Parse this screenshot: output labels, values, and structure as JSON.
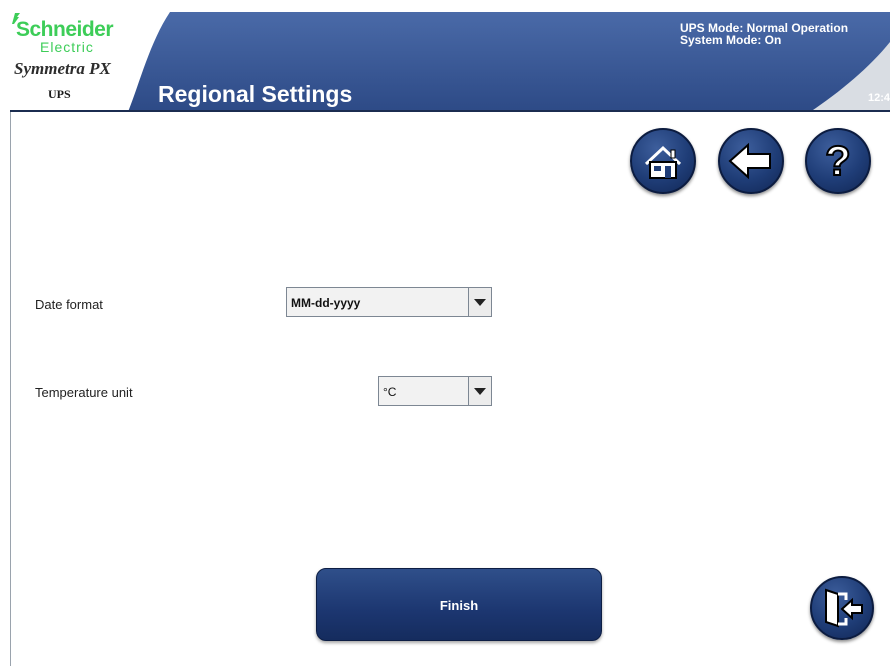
{
  "brand": {
    "company_line1": "Schneider",
    "company_line2": "Electric",
    "product": "Symmetra PX",
    "product_sub": "UPS"
  },
  "header": {
    "title": "Regional Settings",
    "ups_mode": "UPS Mode: Normal Operation",
    "system_mode": "System Mode: On",
    "clock": "12:4"
  },
  "nav": {
    "home_icon": "home-icon",
    "back_icon": "arrow-left-icon",
    "help_icon": "question-mark-icon",
    "help_glyph": "?",
    "exit_icon": "exit-door-icon"
  },
  "form": {
    "date_format": {
      "label": "Date format",
      "value": "MM-dd-yyyy"
    },
    "temperature_unit": {
      "label": "Temperature unit",
      "value": "°C"
    }
  },
  "actions": {
    "finish_label": "Finish"
  },
  "colors": {
    "header_blue": "#3b5998",
    "button_navy": "#1c3670",
    "brand_green": "#3dcd58"
  }
}
